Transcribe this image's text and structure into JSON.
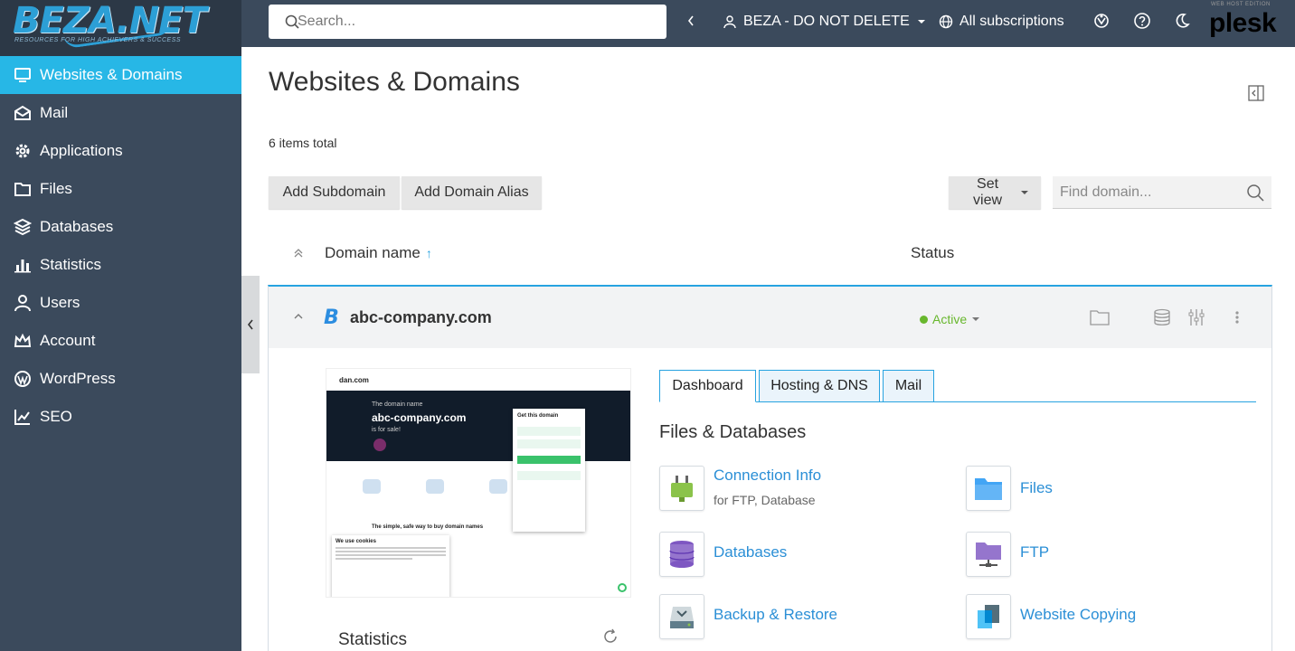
{
  "brand": {
    "logo_text": "BEZA.NET",
    "logo_tagline": "RESOURCES FOR HIGH ACHIEVERS & SUCCESS"
  },
  "sidebar": {
    "items": [
      {
        "label": "Websites & Domains",
        "icon": "monitor-icon",
        "active": true
      },
      {
        "label": "Mail",
        "icon": "mail-icon"
      },
      {
        "label": "Applications",
        "icon": "gear-icon"
      },
      {
        "label": "Files",
        "icon": "folder-icon"
      },
      {
        "label": "Databases",
        "icon": "layers-icon"
      },
      {
        "label": "Statistics",
        "icon": "bar-chart-icon"
      },
      {
        "label": "Users",
        "icon": "user-icon"
      },
      {
        "label": "Account",
        "icon": "crown-icon"
      },
      {
        "label": "WordPress",
        "icon": "wordpress-icon"
      },
      {
        "label": "SEO",
        "icon": "seo-chart-icon"
      }
    ]
  },
  "topbar": {
    "search_placeholder": "Search...",
    "subscription": "BEZA - DO NOT DELETE",
    "all_subscriptions": "All subscriptions",
    "plesk_label": "plesk",
    "plesk_small": "WEB HOST EDITION"
  },
  "main": {
    "title": "Websites & Domains",
    "items_total": "6 items total",
    "add_subdomain": "Add Subdomain",
    "add_domain_alias": "Add Domain Alias",
    "set_view": "Set view",
    "find_placeholder": "Find domain...",
    "col_domain": "Domain name",
    "col_status": "Status"
  },
  "domain": {
    "logo_letter": "B",
    "name": "abc-company.com",
    "status": "Active",
    "status_color": "#68b72d",
    "preview": {
      "site": "dan.com",
      "line1": "The domain name",
      "line2": "abc-company.com",
      "line3": "is for sale!",
      "card_title": "Get this domain",
      "heading": "The simple, safe way to buy domain names",
      "cookie_title": "We use cookies"
    },
    "statistics_title": "Statistics",
    "tabs": [
      {
        "label": "Dashboard",
        "active": true
      },
      {
        "label": "Hosting & DNS"
      },
      {
        "label": "Mail"
      }
    ],
    "section_title": "Files & Databases",
    "tiles": [
      {
        "label": "Connection Info",
        "desc": "for FTP, Database",
        "icon": "plug-icon"
      },
      {
        "label": "Files",
        "icon": "files-folder-icon"
      },
      {
        "label": "Databases",
        "icon": "database-icon"
      },
      {
        "label": "FTP",
        "icon": "ftp-icon"
      },
      {
        "label": "Backup & Restore",
        "icon": "backup-icon"
      },
      {
        "label": "Website Copying",
        "icon": "copy-icon"
      }
    ]
  },
  "colors": {
    "sidebar": "#3b4a5c",
    "active": "#27b7e6",
    "link": "#2b8fd6"
  }
}
